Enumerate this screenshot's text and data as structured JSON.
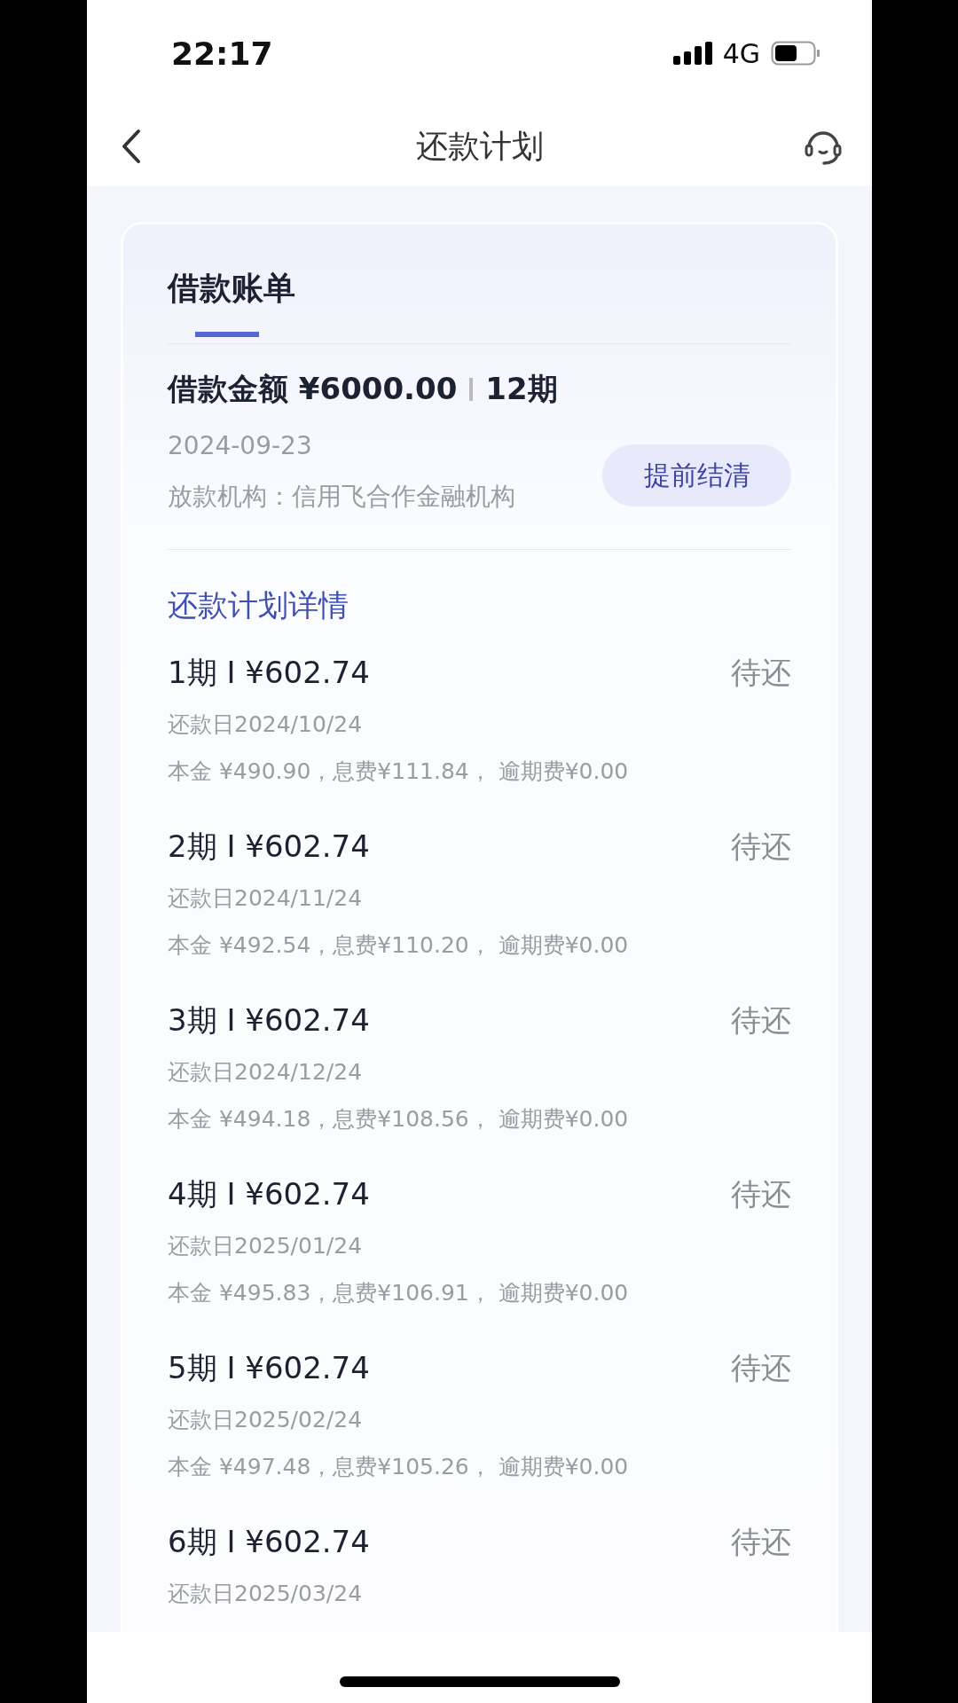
{
  "status_bar": {
    "time": "22:17",
    "network": "4G"
  },
  "nav": {
    "title": "还款计划"
  },
  "bill": {
    "tab": "借款账单",
    "amount_label": "借款金额 ¥6000.00",
    "terms": "12期",
    "date": "2024-09-23",
    "lender": "放款机构：信用飞合作金融机构",
    "payoff_button": "提前结清"
  },
  "plan": {
    "title": "还款计划详情",
    "rows": [
      {
        "title": "1期 I ¥602.74",
        "status": "待还",
        "due": "还款日2024/10/24",
        "detail": "本金 ¥490.90，息费¥111.84， 逾期费¥0.00"
      },
      {
        "title": "2期 I ¥602.74",
        "status": "待还",
        "due": "还款日2024/11/24",
        "detail": "本金 ¥492.54，息费¥110.20， 逾期费¥0.00"
      },
      {
        "title": "3期 I ¥602.74",
        "status": "待还",
        "due": "还款日2024/12/24",
        "detail": "本金 ¥494.18，息费¥108.56， 逾期费¥0.00"
      },
      {
        "title": "4期 I ¥602.74",
        "status": "待还",
        "due": "还款日2025/01/24",
        "detail": "本金 ¥495.83，息费¥106.91， 逾期费¥0.00"
      },
      {
        "title": "5期 I ¥602.74",
        "status": "待还",
        "due": "还款日2025/02/24",
        "detail": "本金 ¥497.48，息费¥105.26， 逾期费¥0.00"
      },
      {
        "title": "6期 I ¥602.74",
        "status": "待还",
        "due": "还款日2025/03/24"
      }
    ]
  }
}
